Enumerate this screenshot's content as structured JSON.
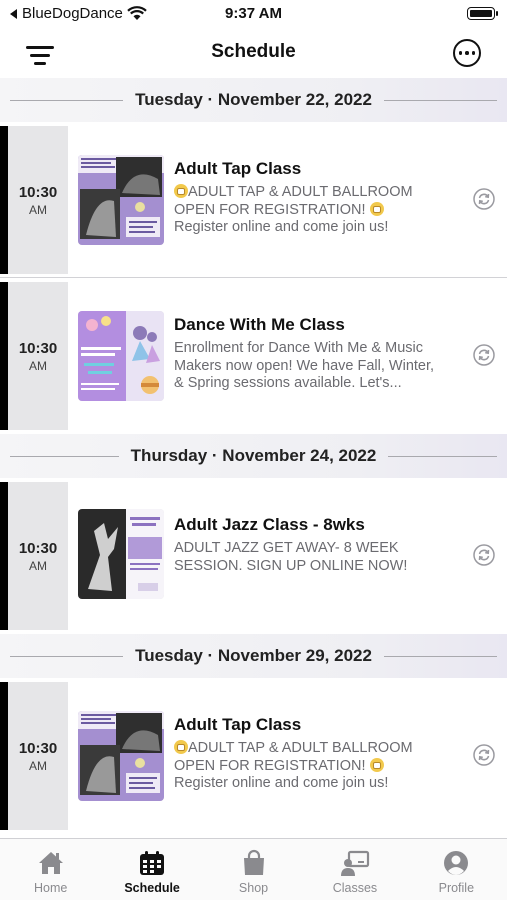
{
  "status_bar": {
    "back_app": "BlueDogDance",
    "time": "9:37 AM"
  },
  "header": {
    "title": "Schedule",
    "menu_icon": "hamburger-icon",
    "more_icon": "more-icon"
  },
  "schedule": [
    {
      "date": "Tuesday · November 22, 2022",
      "events": [
        {
          "time": "10:30",
          "ampm": "AM",
          "title": "Adult Tap Class",
          "desc_line1": "ADULT TAP & ADULT BALLROOM",
          "desc_line2": "OPEN FOR REGISTRATION!",
          "desc_line3": "Register online and come join us!",
          "thumb": "tap"
        },
        {
          "time": "10:30",
          "ampm": "AM",
          "title": "Dance With Me Class",
          "desc_line1": "Enrollment for Dance With Me & Music",
          "desc_line2": "Makers now open! We have Fall, Winter,",
          "desc_line3": "& Spring sessions available. Let's...",
          "thumb": "dance"
        }
      ]
    },
    {
      "date": "Thursday · November 24, 2022",
      "events": [
        {
          "time": "10:30",
          "ampm": "AM",
          "title": "Adult Jazz Class - 8wks",
          "desc_line1": "ADULT JAZZ GET AWAY- 8 WEEK",
          "desc_line2": "SESSION. SIGN UP ONLINE NOW!",
          "desc_line3": "",
          "thumb": "jazz"
        }
      ]
    },
    {
      "date": "Tuesday · November 29, 2022",
      "events": [
        {
          "time": "10:30",
          "ampm": "AM",
          "title": "Adult Tap Class",
          "desc_line1": "ADULT TAP & ADULT BALLROOM",
          "desc_line2": "OPEN FOR REGISTRATION!",
          "desc_line3": "Register online and come join us!",
          "thumb": "tap"
        }
      ]
    }
  ],
  "tabs": [
    {
      "label": "Home",
      "icon": "home-icon",
      "active": false
    },
    {
      "label": "Schedule",
      "icon": "calendar-icon",
      "active": true
    },
    {
      "label": "Shop",
      "icon": "shopping-bag-icon",
      "active": false
    },
    {
      "label": "Classes",
      "icon": "classes-icon",
      "active": false
    },
    {
      "label": "Profile",
      "icon": "profile-icon",
      "active": false
    }
  ],
  "colors": {
    "accent": "#000000",
    "time_box": "#e6e6e8",
    "thumb_purple": "#9b86c9",
    "tab_active": "#111111",
    "tab_inactive": "#8a8a8e"
  }
}
